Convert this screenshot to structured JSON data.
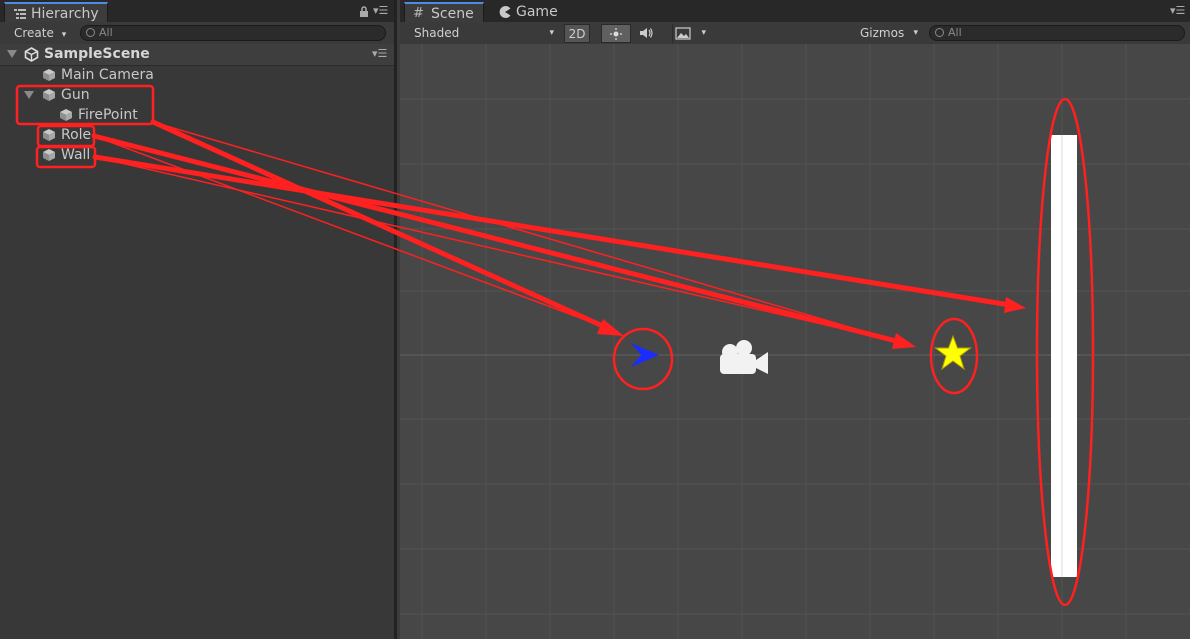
{
  "hierarchy": {
    "tab_label": "Hierarchy",
    "create_label": "Create",
    "search_placeholder": "All",
    "scene_name": "SampleScene",
    "items": [
      {
        "label": "Main Camera"
      },
      {
        "label": "Gun"
      },
      {
        "label": "FirePoint"
      },
      {
        "label": "Role"
      },
      {
        "label": "Wall"
      }
    ]
  },
  "scene": {
    "tabs": [
      {
        "label": "Scene"
      },
      {
        "label": "Game"
      }
    ],
    "shading_mode": "Shaded",
    "mode_2d_label": "2D",
    "gizmos_label": "Gizmos",
    "search_placeholder": "All"
  },
  "colors": {
    "annotation": "#ff2020",
    "role_arrow": "#1a2cff",
    "star": "#ffff00",
    "wall": "#ffffff",
    "accent_tab": "#4d8ce0"
  }
}
